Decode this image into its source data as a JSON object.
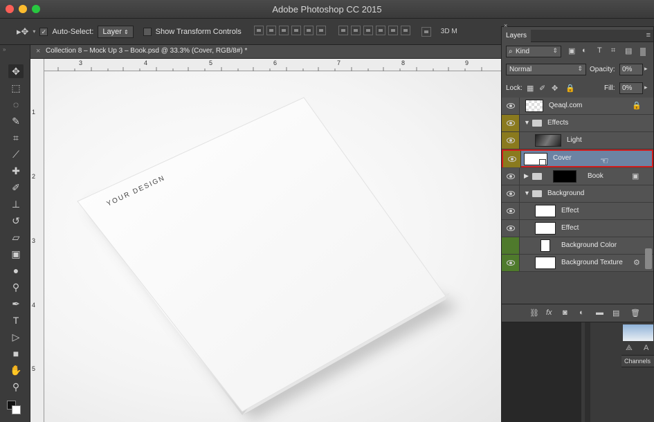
{
  "app": {
    "window_title": "Adobe Photoshop CC 2015",
    "doc_tab": "Collection 8 – Mock Up 3 – Book.psd @ 33.3% (Cover, RGB/8#) *"
  },
  "options": {
    "auto_select_label": "Auto-Select:",
    "auto_select_value": "Layer",
    "show_transform_label": "Show Transform Controls",
    "mode_3d": "3D M"
  },
  "rulers": {
    "h": [
      "3",
      "4",
      "5",
      "6",
      "7",
      "8",
      "9"
    ],
    "v": [
      "1",
      "2",
      "3",
      "4",
      "5"
    ]
  },
  "canvas": {
    "cover_text": "YOUR DESIGN"
  },
  "layers_panel": {
    "title": "Layers",
    "filter_kind": "Kind",
    "blend_mode": "Normal",
    "opacity_label": "Opacity:",
    "opacity_value": "0%",
    "lock_label": "Lock:",
    "fill_label": "Fill:",
    "fill_value": "0%",
    "layers": [
      {
        "name": "Qeaql.com"
      },
      {
        "name": "Effects"
      },
      {
        "name": "Light"
      },
      {
        "name": "Cover"
      },
      {
        "name": "Book"
      },
      {
        "name": "Background"
      },
      {
        "name": "Effect"
      },
      {
        "name": "Effect"
      },
      {
        "name": "Background Color"
      },
      {
        "name": "Background Texture"
      }
    ]
  },
  "right_dock": {
    "channels_label": "Channels"
  },
  "colors": {
    "panel_bg": "#4a4a4a",
    "selected_row": "#6c83a3",
    "highlight_red": "#d11c1c",
    "eye_yellow": "#8a7a1e",
    "eye_green": "#4f7a2c"
  }
}
